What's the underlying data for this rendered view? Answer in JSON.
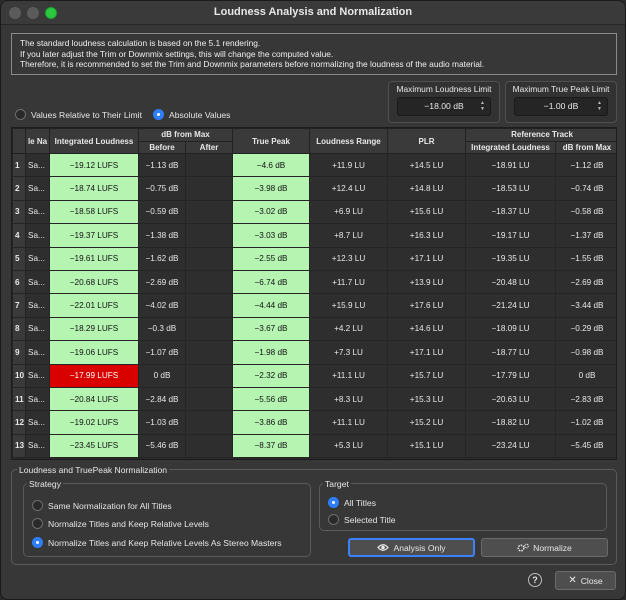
{
  "window": {
    "title": "Loudness Analysis and Normalization"
  },
  "info": {
    "line1": "The standard loudness calculation is based on the 5.1 rendering.",
    "line2": "If you later adjust the Trim or Downmix settings, this will change the computed value.",
    "line3": "Therefore, it is recommended to set the Trim and Downmix parameters before normalizing the loudness of the audio material."
  },
  "limits": {
    "loudness_label": "Maximum Loudness Limit",
    "loudness_value": "−18.00 dB",
    "truepeak_label": "Maximum True Peak Limit",
    "truepeak_value": "−1.00 dB"
  },
  "value_mode": {
    "relative_label": "Values Relative to Their Limit",
    "absolute_label": "Absolute Values",
    "selected": "absolute"
  },
  "table": {
    "headers": {
      "name": "le Na",
      "integrated": "Integrated Loudness",
      "dbfrommax": "dB from Max",
      "before": "Before",
      "after": "After",
      "truepeak": "True Peak",
      "range": "Loudness Range",
      "plr": "PLR",
      "reference": "Reference Track",
      "ref_integrated": "Integrated Loudness",
      "ref_dbfrommax": "dB from Max"
    },
    "colors": {
      "green": "#b6f4b2",
      "red": "#d90000"
    },
    "rows": [
      {
        "idx": "1",
        "name": "Sa...",
        "integrated": "−19.12 LUFS",
        "before": "−1.13 dB",
        "after": "",
        "truepeak": "−4.6 dB",
        "range": "+11.9 LU",
        "plr": "+14.5 LU",
        "ref_int": "−18.91 LU",
        "ref_db": "−1.12 dB",
        "flag": "green"
      },
      {
        "idx": "2",
        "name": "Sa...",
        "integrated": "−18.74 LUFS",
        "before": "−0.75 dB",
        "after": "",
        "truepeak": "−3.98 dB",
        "range": "+12.4 LU",
        "plr": "+14.8 LU",
        "ref_int": "−18.53 LU",
        "ref_db": "−0.74 dB",
        "flag": "green"
      },
      {
        "idx": "3",
        "name": "Sa...",
        "integrated": "−18.58 LUFS",
        "before": "−0.59 dB",
        "after": "",
        "truepeak": "−3.02 dB",
        "range": "+6.9 LU",
        "plr": "+15.6 LU",
        "ref_int": "−18.37 LU",
        "ref_db": "−0.58 dB",
        "flag": "green"
      },
      {
        "idx": "4",
        "name": "Sa...",
        "integrated": "−19.37 LUFS",
        "before": "−1.38 dB",
        "after": "",
        "truepeak": "−3.03 dB",
        "range": "+8.7 LU",
        "plr": "+16.3 LU",
        "ref_int": "−19.17 LU",
        "ref_db": "−1.37 dB",
        "flag": "green"
      },
      {
        "idx": "5",
        "name": "Sa...",
        "integrated": "−19.61 LUFS",
        "before": "−1.62 dB",
        "after": "",
        "truepeak": "−2.55 dB",
        "range": "+12.3 LU",
        "plr": "+17.1 LU",
        "ref_int": "−19.35 LU",
        "ref_db": "−1.55 dB",
        "flag": "green"
      },
      {
        "idx": "6",
        "name": "Sa...",
        "integrated": "−20.68 LUFS",
        "before": "−2.69 dB",
        "after": "",
        "truepeak": "−6.74 dB",
        "range": "+11.7 LU",
        "plr": "+13.9 LU",
        "ref_int": "−20.48 LU",
        "ref_db": "−2.69 dB",
        "flag": "green"
      },
      {
        "idx": "7",
        "name": "Sa...",
        "integrated": "−22.01 LUFS",
        "before": "−4.02 dB",
        "after": "",
        "truepeak": "−4.44 dB",
        "range": "+15.9 LU",
        "plr": "+17.6 LU",
        "ref_int": "−21.24 LU",
        "ref_db": "−3.44 dB",
        "flag": "green"
      },
      {
        "idx": "8",
        "name": "Sa...",
        "integrated": "−18.29 LUFS",
        "before": "−0.3 dB",
        "after": "",
        "truepeak": "−3.67 dB",
        "range": "+4.2 LU",
        "plr": "+14.6 LU",
        "ref_int": "−18.09 LU",
        "ref_db": "−0.29 dB",
        "flag": "green"
      },
      {
        "idx": "9",
        "name": "Sa...",
        "integrated": "−19.06 LUFS",
        "before": "−1.07 dB",
        "after": "",
        "truepeak": "−1.98 dB",
        "range": "+7.3 LU",
        "plr": "+17.1 LU",
        "ref_int": "−18.77 LU",
        "ref_db": "−0.98 dB",
        "flag": "green"
      },
      {
        "idx": "10",
        "name": "Sa...",
        "integrated": "−17.99 LUFS",
        "before": "0 dB",
        "after": "",
        "truepeak": "−2.32 dB",
        "range": "+11.1 LU",
        "plr": "+15.7 LU",
        "ref_int": "−17.79 LU",
        "ref_db": "0 dB",
        "flag": "red"
      },
      {
        "idx": "11",
        "name": "Sa...",
        "integrated": "−20.84 LUFS",
        "before": "−2.84 dB",
        "after": "",
        "truepeak": "−5.56 dB",
        "range": "+8.3 LU",
        "plr": "+15.3 LU",
        "ref_int": "−20.63 LU",
        "ref_db": "−2.83 dB",
        "flag": "green"
      },
      {
        "idx": "12",
        "name": "Sa...",
        "integrated": "−19.02 LUFS",
        "before": "−1.03 dB",
        "after": "",
        "truepeak": "−3.86 dB",
        "range": "+11.1 LU",
        "plr": "+15.2 LU",
        "ref_int": "−18.82 LU",
        "ref_db": "−1.02 dB",
        "flag": "green"
      },
      {
        "idx": "13",
        "name": "Sa...",
        "integrated": "−23.45 LUFS",
        "before": "−5.46 dB",
        "after": "",
        "truepeak": "−8.37 dB",
        "range": "+5.3 LU",
        "plr": "+15.1 LU",
        "ref_int": "−23.24 LU",
        "ref_db": "−5.45 dB",
        "flag": "green"
      }
    ]
  },
  "normalization": {
    "group_label": "Loudness and TruePeak Normalization",
    "strategy_label": "Strategy",
    "strategy_options": [
      {
        "label": "Same Normalization for All Titles",
        "selected": false
      },
      {
        "label": "Normalize Titles and Keep Relative Levels",
        "selected": false
      },
      {
        "label": "Normalize Titles and Keep Relative Levels As Stereo Masters",
        "selected": true
      }
    ],
    "target_label": "Target",
    "target_options": [
      {
        "label": "All Titles",
        "selected": true
      },
      {
        "label": "Selected Title",
        "selected": false
      }
    ]
  },
  "buttons": {
    "analysis_only": "Analysis Only",
    "normalize": "Normalize",
    "help": "?",
    "close": "Close"
  }
}
